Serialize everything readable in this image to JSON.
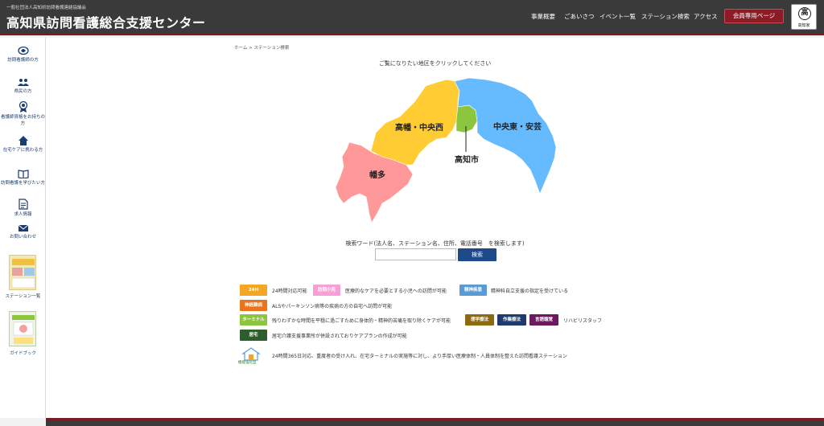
{
  "header": {
    "subtitle": "一般社団法人高知県訪問看護連絡協議会",
    "title": "高知県訪問看護総合支援センター",
    "nav": [
      "事業概要",
      "ごあいさつ",
      "イベント一覧",
      "ステーション検索",
      "アクセス"
    ],
    "member_button": "会員専用ページ",
    "logo_char": "高",
    "logo_text": "高知家"
  },
  "sidebar": {
    "items": [
      {
        "label": "訪問看護師の方",
        "icon": "nurse-icon"
      },
      {
        "label": "県民の方",
        "icon": "people-icon"
      },
      {
        "label": "看護師資格をお持ちの方",
        "icon": "badge-icon"
      },
      {
        "label": "在宅ケアに携わる方",
        "icon": "home-icon"
      },
      {
        "label": "訪問看護を学びたい方",
        "icon": "book-icon"
      },
      {
        "label": "求人情報",
        "icon": "document-icon"
      },
      {
        "label": "お問い合わせ",
        "icon": "mail-icon"
      }
    ],
    "thumbs": [
      {
        "label": "ステーション一覧"
      },
      {
        "label": "ガイドブック"
      }
    ]
  },
  "main": {
    "breadcrumb": "ホーム > ステーション検索",
    "instruction": "ご覧になりたい地区をクリックしてください",
    "regions": [
      {
        "name": "高幡・中央西",
        "color": "#ffcc33"
      },
      {
        "name": "中央東・安芸",
        "color": "#66bbff"
      },
      {
        "name": "高知市",
        "color": "#8cc63f"
      },
      {
        "name": "幡多",
        "color": "#ff9999"
      }
    ],
    "search": {
      "label": "検索ワード(法人名、ステーション名、住所、電話番号　を検索します)",
      "placeholder": "",
      "button": "検索"
    },
    "legend": {
      "tag_24h": "24H",
      "text_24h": "24時間対応可能",
      "tag_child": "訪問小児",
      "text_child": "医療的なケアを必要とする小児への訪問が可能",
      "tag_psych": "精神疾患",
      "text_psych": "精神科自立支援の指定を受けている",
      "tag_neuro": "神経難病",
      "text_neuro": "ALSやパーキンソン病等の疾病の方の自宅へ訪問が可能",
      "tag_term": "ターミナル",
      "text_term": "残りわずかな時間を平穏に過ごすために身体的・精神的苦痛を取り除くケアが可能",
      "tag_pt": "理学療法",
      "tag_ot": "作業療法",
      "tag_st": "言語聴覚",
      "text_rehab": "リハビリスタッフ",
      "tag_care": "居宅",
      "text_care": "居宅介護支援事業所が併設されておりケアプランの作成が可能",
      "function_label": "機能強化型",
      "text_function": "24時間365日対応、重度者の受け入れ、在宅ターミナルの実施等に対し、より手厚い医療体制・人員体制を整えた訪問看護ステーション"
    },
    "colors": {
      "tag_24h": "#f5a623",
      "tag_child": "#f7a0d8",
      "tag_psych": "#5b9bd5",
      "tag_neuro": "#e8741e",
      "tag_term": "#8cc63f",
      "tag_pt": "#8b6a10",
      "tag_ot": "#1e3a6e",
      "tag_st": "#6b1a5e",
      "tag_care": "#2e5e2e"
    }
  }
}
